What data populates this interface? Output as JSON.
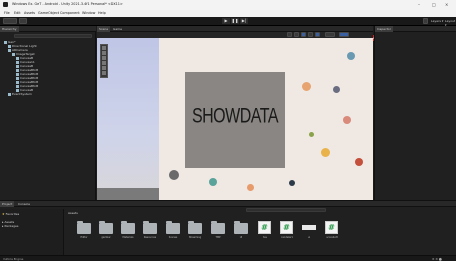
{
  "window": {
    "title": "Windows Ex. GeT - Android - Unity 2021.3.4f1 Personal* <DX11>"
  },
  "menu": [
    "File",
    "Edit",
    "Assets",
    "GameObject",
    "Component",
    "Window",
    "Help"
  ],
  "toolbar": {
    "package_badge": "Experimental Packages in Use ▾",
    "layers_label": "Layers ▾",
    "layout_label": "Layout ▾"
  },
  "hierarchy": {
    "tab": "Hierarchy",
    "items": [
      {
        "label": "Gen*"
      },
      {
        "label": "Directional Light"
      },
      {
        "label": "ARCamera"
      },
      {
        "label": "ImageTarget"
      },
      {
        "label": "CanvasB"
      },
      {
        "label": "Canvas11"
      },
      {
        "label": "CanvasB"
      },
      {
        "label": "CanvasBtnB"
      },
      {
        "label": "CanvasBtnB"
      },
      {
        "label": "CanvasBtnB"
      },
      {
        "label": "CanvasBtnB"
      },
      {
        "label": "CanvasBtnB"
      },
      {
        "label": "CanvasB"
      },
      {
        "label": "EventSystem"
      }
    ]
  },
  "scene": {
    "tabs": [
      "Scene",
      "Game"
    ],
    "content_text": "SHOWDATA"
  },
  "inspector": {
    "tab": "Inspector"
  },
  "project": {
    "tabs": [
      "Project",
      "Console"
    ],
    "sidebar": [
      "Favorites",
      "Assets",
      "Packages"
    ],
    "breadcrumb": "Assets",
    "assets": [
      {
        "label": "Editor",
        "kind": "folder"
      },
      {
        "label": "gambar",
        "kind": "folder"
      },
      {
        "label": "Materials",
        "kind": "folder"
      },
      {
        "label": "Resources",
        "kind": "folder"
      },
      {
        "label": "Scenes",
        "kind": "folder"
      },
      {
        "label": "Streaming",
        "kind": "folder"
      },
      {
        "label": "TMP",
        "kind": "folder"
      },
      {
        "label": "UI",
        "kind": "folder"
      },
      {
        "label": "tes",
        "kind": "script"
      },
      {
        "label": "candelar1",
        "kind": "script"
      },
      {
        "label": "ui",
        "kind": "material"
      },
      {
        "label": "scorebutt",
        "kind": "script"
      }
    ]
  },
  "status": {
    "left": "Vuforia Engine",
    "right": "⚙ ⚙ ⬤"
  },
  "colors": {
    "badge": "#cc2222",
    "accent": "#2a9a4a"
  }
}
